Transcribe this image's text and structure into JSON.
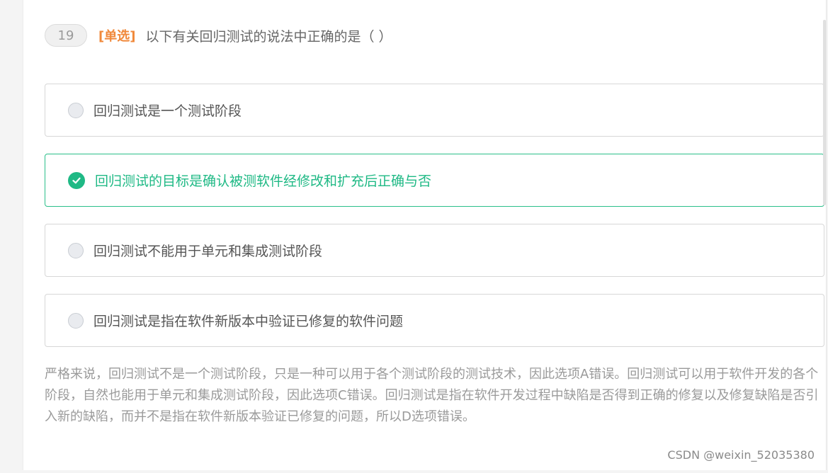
{
  "question": {
    "number": "19",
    "type": "[单选]",
    "text": "以下有关回归测试的说法中正确的是（ ）"
  },
  "options": [
    {
      "label": "回归测试是一个测试阶段",
      "state": "unselected"
    },
    {
      "label": "回归测试的目标是确认被测软件经修改和扩充后正确与否",
      "state": "correct"
    },
    {
      "label": "回归测试不能用于单元和集成测试阶段",
      "state": "unselected"
    },
    {
      "label": "回归测试是指在软件新版本中验证已修复的软件问题",
      "state": "unselected"
    }
  ],
  "explanation": "严格来说，回归测试不是一个测试阶段，只是一种可以用于各个测试阶段的测试技术，因此选项A错误。回归测试可以用于软件开发的各个阶段，自然也能用于单元和集成测试阶段，因此选项C错误。回归测试是指在软件开发过程中缺陷是否得到正确的修复以及修复缺陷是否引入新的缺陷，而并不是指在软件新版本验证已修复的问题，所以D选项错误。",
  "watermark": "CSDN @weixin_52035380",
  "colors": {
    "accent_correct": "#1fb985",
    "question_type": "#f0883a",
    "explanation_text": "#9a9a9a"
  }
}
